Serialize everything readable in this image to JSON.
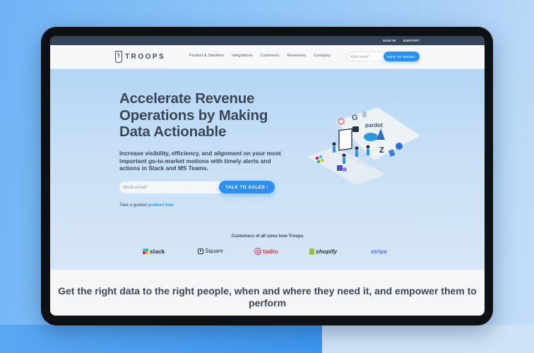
{
  "topbar": {
    "links": [
      "SIGN IN",
      "SUPPORT"
    ]
  },
  "nav": {
    "brand": "TROOPS",
    "links": [
      "Product & Solutions",
      "Integrations",
      "Customers",
      "Resources",
      "Company"
    ],
    "email_placeholder": "Work email*",
    "cta_label": "TALK TO SALES ›"
  },
  "hero": {
    "headline": "Accelerate Revenue Operations by Making Data Actionable",
    "subhead": "Increase visibility, efficiency, and alignment on your most important go-to-market motions with timely alerts and actions in Slack and MS Teams.",
    "email_placeholder": "Work email*",
    "cta_label": "TALK TO SALES ›",
    "tour_prefix": "Take a guided",
    "tour_link": "product tour",
    "illustration_icons": [
      "hubspot-icon",
      "gmail-icon",
      "outreach-icon",
      "pardot-icon",
      "salesforce-icon",
      "dynamics-icon",
      "zendesk-icon",
      "jira-icon",
      "slack-icon",
      "teams-icon"
    ]
  },
  "customers": {
    "title": "Customers of all sizes love Troops",
    "logos": [
      "slack",
      "Square",
      "twilio",
      "shopify",
      "stripe"
    ]
  },
  "bottom": {
    "headline": "Get the right data to the right people, when and where they need it, and empower them to perform"
  },
  "colors": {
    "accent": "#2d8ff0",
    "text": "#3a4656",
    "topbar": "#344459",
    "twilio": "#e0344f",
    "stripe": "#5c72e6",
    "shopify": "#95bf47"
  }
}
